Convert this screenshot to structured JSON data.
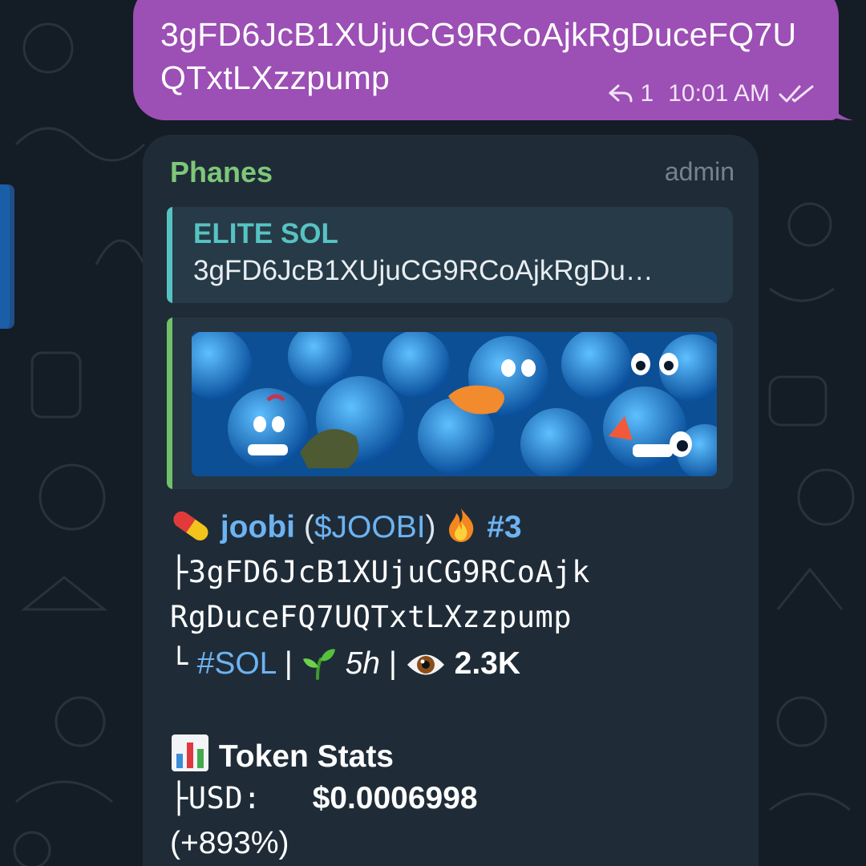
{
  "outgoing": {
    "text": "3gFD6JcB1XUjuCG9RCoAjkRgDuceFQ7UQTxtLXzzpump",
    "reply_count": "1",
    "time": "10:01 AM"
  },
  "incoming": {
    "sender": "Phanes",
    "role": "admin",
    "reply": {
      "title": "ELITE SOL",
      "text": "3gFD6JcB1XUjuCG9RCoAjkRgDu…"
    },
    "token_line": {
      "name": "joobi",
      "paren_open": "(",
      "ticker": "$JOOBI",
      "paren_close": ")",
      "rank": "#3"
    },
    "address_line_1": "├3gFD6JcB1XUjuCG9RCoAjk",
    "address_line_2": "RgDuceFQ7UQTxtLXzzpump",
    "meta_line": {
      "prefix": "└",
      "chain": "#SOL",
      "sep": "|",
      "age": "5h",
      "views": "2.3K"
    },
    "stats": {
      "title": "Token Stats",
      "usd_label": "├USD:",
      "usd_value": "$0.0006998",
      "usd_change": "(+893%)"
    }
  },
  "icons": {
    "reply": "reply-arrow-icon",
    "read": "double-check-icon",
    "pill": "pill-emoji-icon",
    "fire": "fire-emoji-icon",
    "seedling": "seedling-emoji-icon",
    "eye": "eye-emoji-icon",
    "chart": "bar-chart-emoji-icon"
  },
  "colors": {
    "outgoing_bubble": "#9c4fb4",
    "incoming_bubble": "#1f2c38",
    "sender": "#7ec779",
    "reply_accent": "#56c3c2",
    "link": "#6db3f2"
  }
}
